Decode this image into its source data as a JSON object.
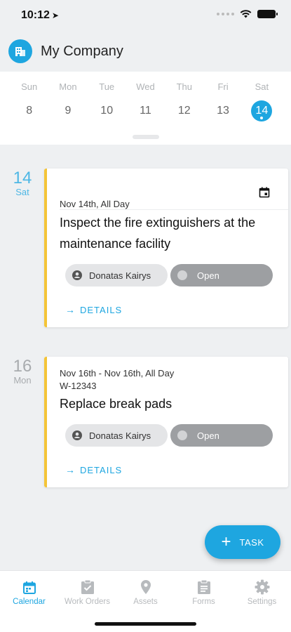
{
  "status_bar": {
    "time": "10:12"
  },
  "header": {
    "company_name": "My Company"
  },
  "week": {
    "days": [
      {
        "name": "Sun",
        "num": "8"
      },
      {
        "name": "Mon",
        "num": "9"
      },
      {
        "name": "Tue",
        "num": "10"
      },
      {
        "name": "Wed",
        "num": "11"
      },
      {
        "name": "Thu",
        "num": "12"
      },
      {
        "name": "Fri",
        "num": "13"
      },
      {
        "name": "Sat",
        "num": "14",
        "selected": true
      }
    ]
  },
  "tasks": [
    {
      "day_num": "14",
      "day_name": "Sat",
      "date_range": "Nov 14th, All Day",
      "work_order": "",
      "title": "Inspect the fire extinguishers at the maintenance facility",
      "assignee": "Donatas Kairys",
      "status": "Open",
      "details_label": "DETAILS"
    },
    {
      "day_num": "16",
      "day_name": "Mon",
      "date_range": "Nov 16th - Nov 16th, All Day",
      "work_order": "W-12343",
      "title": "Replace break pads",
      "assignee": "Donatas Kairys",
      "status": "Open",
      "details_label": "DETAILS"
    }
  ],
  "fab": {
    "label": "TASK"
  },
  "tab_bar": {
    "tabs": [
      {
        "label": "Calendar",
        "icon": "calendar-icon",
        "active": true
      },
      {
        "label": "Work Orders",
        "icon": "clipboard-check-icon"
      },
      {
        "label": "Assets",
        "icon": "map-pin-icon"
      },
      {
        "label": "Forms",
        "icon": "clipboard-list-icon"
      },
      {
        "label": "Settings",
        "icon": "gear-icon"
      }
    ]
  },
  "colors": {
    "accent": "#1ea6e0",
    "card_stripe": "#f4c437",
    "status_chip": "#9d9fa2",
    "background": "#eef0f2"
  }
}
